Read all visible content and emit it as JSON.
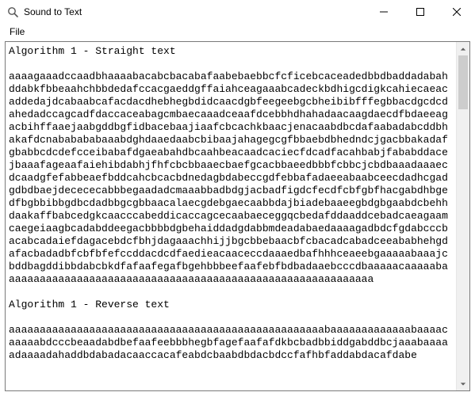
{
  "window": {
    "title": "Sound to Text",
    "icon": "app-icon"
  },
  "menubar": {
    "items": [
      "File"
    ]
  },
  "content": {
    "text": "Algorithm 1 - Straight text\n\naaaagaaadccaadbhaaaabacabcbacabafaabebaebbcfcficebcaceadedbbdbaddadabahddabkfbbeaahchbbdedafccacgaeddgffaiahceagaaabcadeckbdhigcdigkcahiecaeacaddedajdcabaabcafacdacdhebhegbdidcaacdgbfeegeebgcbheibibfffegbbacdgcdcdahedadccagcadfdaccaceabagcmbaecaaadceaafdcebbhdhahadaacaagdaecdfbdaeeagacbihffaaejaabgddbgfidbacebaajiaafcbcachkbaacjenacaabdbcdafaabadabcddbhakafdcnababababaaabdghdaaedaabcbibaajahagegcgfbbaebdbhedndcjgacbbakadafgbabbcdcdefcceibabafdgaeabahdbcaahbeacaadcaciecfdcadfacahbabjfababddacejbaaafageaafaiehibdabhjfhfcbcbbaaecbaefgcacbbaeedbbbfcbbcjcbdbaaadaaaecdcaadgfefabbeaefbddcahcbcacbdnedagbdabeccgdfebbafadaeeabaabceecdadhcgadgdbdbaejdecececabbbegaadadcmaaabbadbdgjacbadfigdcfecdfcbfgbfhacgabdhbgedfbgbbibbgdbcdadbbgcgbbaacalaecgdebgaecaabbdajbiadebaaeegbdgbgaabdcbehhdaakaffbabcedgkcaacccabeddicaccagcecaabaeceggqcbedafddaaddcebadcaeagaamcaegeiaagbcadabddeegacbbbbdgbehaiddadgdabbmdeadabaedaaaagadbdcfgdabcccbacabcadaiefdagacebdcfbhjdagaaachhijjbgcbbebaacbfcbacadcabadceeababhehgdafacbadadbfcbfbfefccddacdcdfaedieacaaceccdaaaedbafhhhceaeebgaaaaabaaajcbddbagddibbdabcbkdfafaafegafbgehbbbeefaafebfbdbadaaebcccdbaaaaacaaaaabaaaaaaaaaaaaaaaaaaaaaaaaaaaaaaaaaaaaaaaaaaaaaaaaaaaaaaaaaaaa\n\nAlgorithm 1 - Reverse text\n\naaaaaaaaaaaaaaaaaaaaaaaaaaaaaaaaaaaaaaaaaaaaaaaaaaabaaaaaaaaaaaaabaaaacaaaaabdcccbeaadabdbefaafeebbbhegbfagefaafafdkbcbadbbiddgabddbcjaaabaaaaadaaaadahaddbdabadacaaccacafeabdcbaabdbdacbdccfafhbfaddabdacafdabe"
  }
}
